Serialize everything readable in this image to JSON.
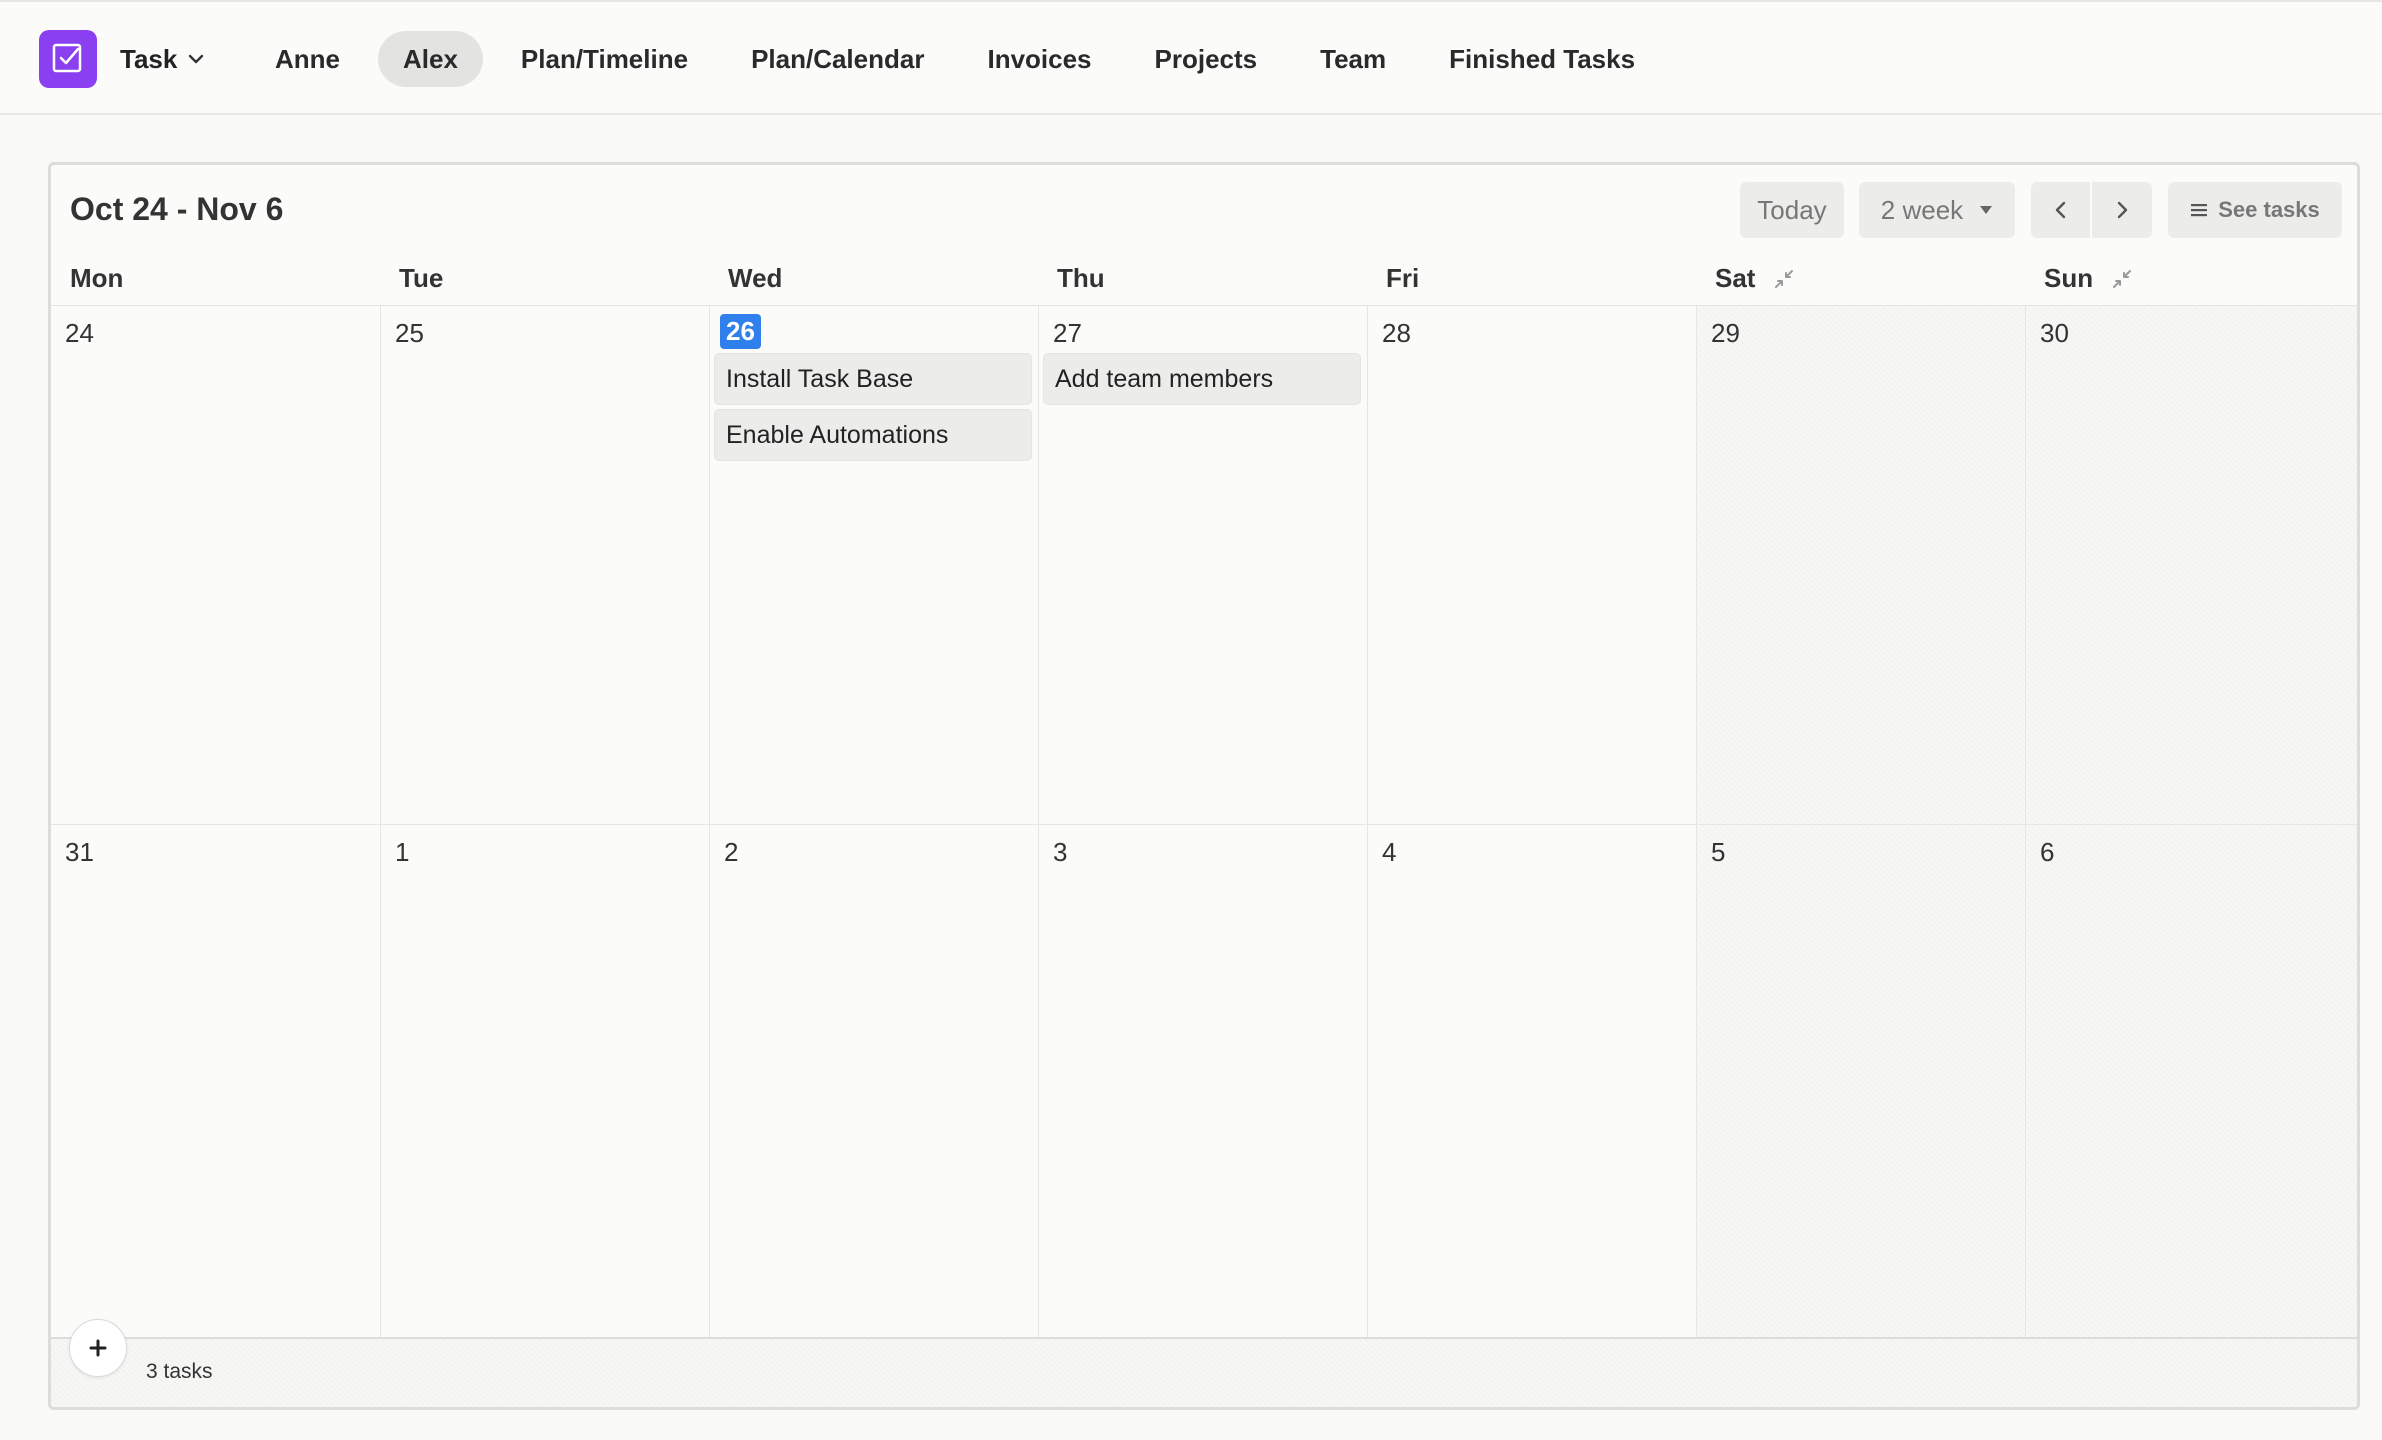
{
  "header": {
    "app_icon": "checkbox-icon",
    "app_name": "Task",
    "nav": [
      {
        "label": "Anne",
        "active": false
      },
      {
        "label": "Alex",
        "active": true
      },
      {
        "label": "Plan/Timeline",
        "active": false
      },
      {
        "label": "Plan/Calendar",
        "active": false
      },
      {
        "label": "Invoices",
        "active": false
      },
      {
        "label": "Projects",
        "active": false
      },
      {
        "label": "Team",
        "active": false
      },
      {
        "label": "Finished Tasks",
        "active": false
      }
    ]
  },
  "calendar": {
    "range_title": "Oct 24 - Nov 6",
    "toolbar": {
      "today_label": "Today",
      "range_label": "2 week",
      "see_tasks_label": "See tasks"
    },
    "weekdays": [
      "Mon",
      "Tue",
      "Wed",
      "Thu",
      "Fri",
      "Sat",
      "Sun"
    ],
    "weeks": [
      [
        "24",
        "25",
        "26",
        "27",
        "28",
        "29",
        "30"
      ],
      [
        "31",
        "1",
        "2",
        "3",
        "4",
        "5",
        "6"
      ]
    ],
    "today": "26",
    "tasks": {
      "wed_26": [
        "Install Task Base",
        "Enable Automations"
      ],
      "thu_27": [
        "Add team members"
      ]
    },
    "footer": {
      "count_label": "3 tasks"
    },
    "colors": {
      "accent": "#8a3ff0",
      "today": "#2f80ed"
    }
  }
}
